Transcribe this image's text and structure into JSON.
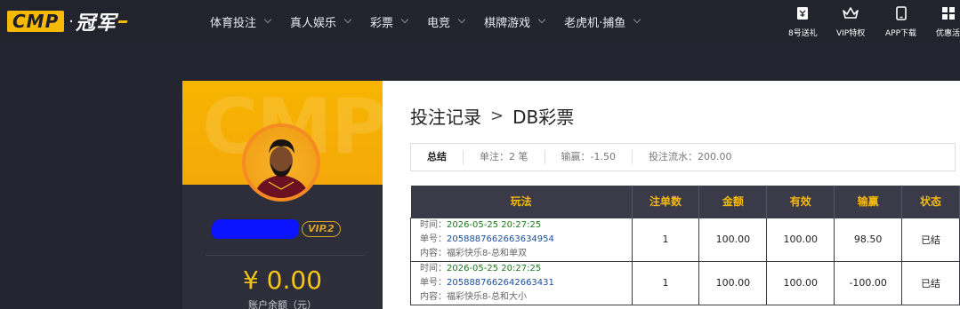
{
  "logo": {
    "brand": "CMP",
    "dot": "·",
    "cn": "冠军"
  },
  "nav": [
    {
      "label": "体育投注"
    },
    {
      "label": "真人娱乐"
    },
    {
      "label": "彩票"
    },
    {
      "label": "电竞"
    },
    {
      "label": "棋牌游戏"
    },
    {
      "label": "老虎机·捕鱼"
    }
  ],
  "quick_links": [
    {
      "label": "8号送礼",
      "icon": "gift-icon"
    },
    {
      "label": "VIP特权",
      "icon": "crown-icon"
    },
    {
      "label": "APP下载",
      "icon": "phone-icon"
    },
    {
      "label": "优惠活",
      "icon": "grid-icon"
    }
  ],
  "profile": {
    "watermark": "CMP",
    "vip": "VIP.2",
    "balance": "¥ 0.00",
    "balance_label": "账户余额（元）"
  },
  "breadcrumb": {
    "parent": "投注记录",
    "separator": ">",
    "current": "DB彩票"
  },
  "summary": {
    "title": "总结",
    "bets": "单注：2 笔",
    "winloss": "输赢：-1.50",
    "turnover": "投注流水：200.00"
  },
  "table": {
    "headers": [
      "玩法",
      "注单数",
      "金额",
      "有效",
      "输赢",
      "状态"
    ],
    "rows": [
      {
        "time_label": "时间：",
        "time": "2026-05-25 20:27:25",
        "no_label": "单号：",
        "no": "2058887662663634954",
        "content_label": "内容：",
        "content": "福彩快乐8-总和单双",
        "count": "1",
        "amount": "100.00",
        "valid": "100.00",
        "winloss": "98.50",
        "status": "已结"
      },
      {
        "time_label": "时间：",
        "time": "2026-05-25 20:27:25",
        "no_label": "单号：",
        "no": "2058887662642663431",
        "content_label": "内容：",
        "content": "福彩快乐8-总和大小",
        "count": "1",
        "amount": "100.00",
        "valid": "100.00",
        "winloss": "-100.00",
        "status": "已结"
      }
    ]
  },
  "colors": {
    "accent": "#f5b90a",
    "win": "#1b8a1b",
    "loss": "#e0202a",
    "dark": "#252532"
  }
}
